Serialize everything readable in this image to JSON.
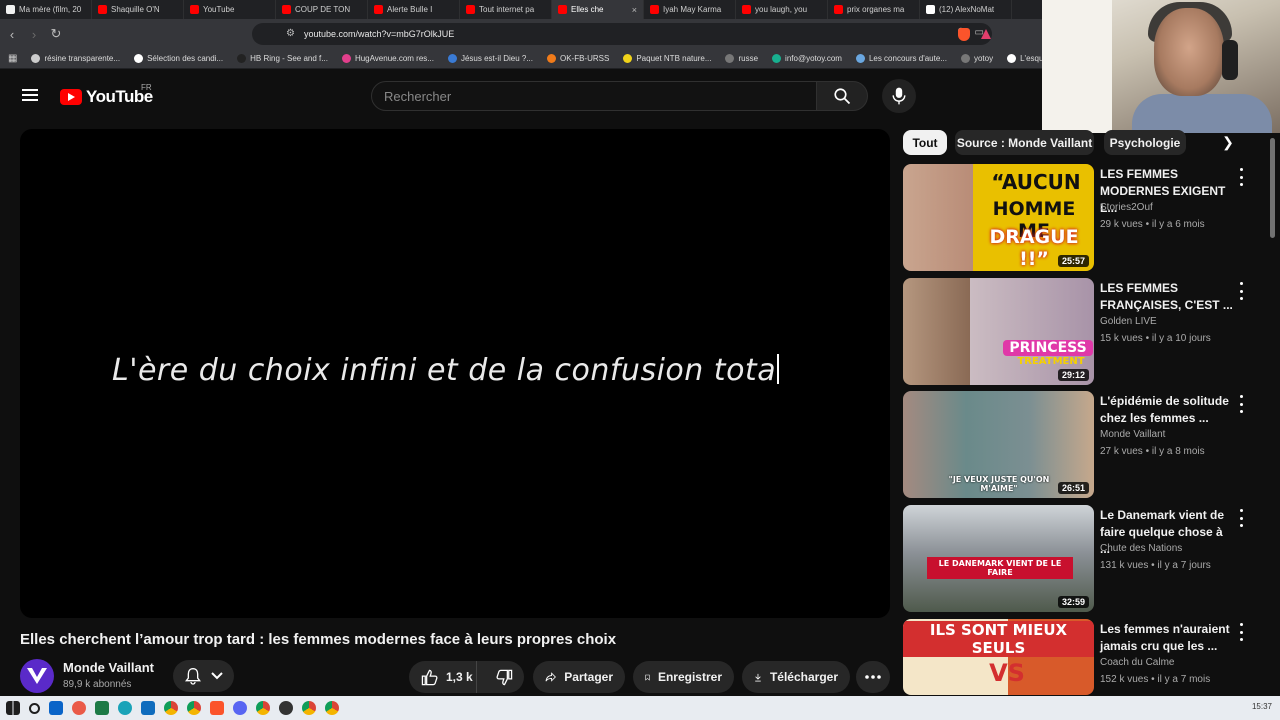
{
  "browser": {
    "tabs": [
      {
        "label": "Ma mère (film, 20",
        "color": "#f1f1f1"
      },
      {
        "label": "Shaquille O'N",
        "color": "#ff0000"
      },
      {
        "label": "YouTube",
        "color": "#ff0000"
      },
      {
        "label": "COUP DE TON",
        "color": "#ff0000"
      },
      {
        "label": "Alerte Bulle I",
        "color": "#ff0000"
      },
      {
        "label": "Tout internet pa",
        "color": "#ff0000"
      },
      {
        "label": "Elles che",
        "color": "#ff0000",
        "active": true
      },
      {
        "label": "Iyah May Karma",
        "color": "#ff0000"
      },
      {
        "label": "you laugh, you",
        "color": "#ff0000"
      },
      {
        "label": "prix organes ma",
        "color": "#ff0000"
      },
      {
        "label": "(12) AlexNoMat",
        "color": "#ffffff"
      }
    ],
    "url": "youtube.com/watch?v=mbG7rOlkJUE",
    "bookmarks": [
      {
        "label": "résine transparente...",
        "color": "#cccccc"
      },
      {
        "label": "Sélection des candi...",
        "color": "#ffffff"
      },
      {
        "label": "HB Ring - See and f...",
        "color": "#222222"
      },
      {
        "label": "HugAvenue.com res...",
        "color": "#e23f8c"
      },
      {
        "label": "Jésus est-il Dieu ?...",
        "color": "#3a7bd5"
      },
      {
        "label": "OK-FB-URSS",
        "color": "#f07b1a"
      },
      {
        "label": "Paquet NTB nature...",
        "color": "#f0d31a"
      },
      {
        "label": "russe",
        "color": "#777777"
      },
      {
        "label": "info@yotoy.com",
        "color": "#18b08f"
      },
      {
        "label": "Les concours d'aute...",
        "color": "#6aa7e0"
      },
      {
        "label": "yotoy",
        "color": "#777777"
      },
      {
        "label": "L'esqu",
        "color": "#ffffff"
      }
    ]
  },
  "youtube": {
    "logo_text": "YouTube",
    "country_code": "FR",
    "search_placeholder": "Rechercher"
  },
  "video": {
    "caption": "L'ère du choix infini et de la confusion tota",
    "title": "Elles cherchent l’amour trop tard : les femmes modernes face à leurs propres choix",
    "channel": "Monde Vaillant",
    "subscribers": "89,9 k abonnés",
    "likes": "1,3 k",
    "share_label": "Partager",
    "save_label": "Enregistrer",
    "download_label": "Télécharger"
  },
  "chips": [
    "Tout",
    "Source : Monde Vaillant",
    "Psychologie"
  ],
  "recommendations": [
    {
      "title": "LES FEMMES MODERNES EXIGENT L...",
      "channel": "Stories2Ouf",
      "meta": "29 k vues • il y a 6 mois",
      "duration": "25:57",
      "thumb_text": [
        "“AUCUN",
        "HOMME ME",
        "DRAGUE !!”"
      ],
      "colors": {
        "bg": "#e9c000",
        "accent": "#d52b1e"
      }
    },
    {
      "title": "LES FEMMES FRANÇAISES, C'EST ...",
      "channel": "Golden LIVE",
      "meta": "15 k vues • il y a 10 jours",
      "duration": "29:12",
      "thumb_text": [
        "PRINCESS",
        "TREATMENT"
      ],
      "colors": {
        "bg": "#b9a8b8",
        "accent": "#e038a8"
      }
    },
    {
      "title": "L'épidémie de solitude chez les femmes ...",
      "channel": "Monde Vaillant",
      "meta": "27 k vues • il y a 8 mois",
      "duration": "26:51",
      "thumb_text": [
        "\"JE VEUX JUSTE QU'ON M'AIME\""
      ],
      "colors": {
        "bg": "#8a7a78",
        "accent": "#ff2d2d"
      }
    },
    {
      "title": "Le Danemark vient de faire quelque chose à ...",
      "channel": "Chute des Nations",
      "meta": "131 k vues • il y a 7 jours",
      "duration": "32:59",
      "thumb_text": [
        "LE DANEMARK VIENT DE LE FAIRE"
      ],
      "colors": {
        "bg": "#6b7075",
        "accent": "#c8102e"
      }
    },
    {
      "title": "Les femmes n'auraient jamais cru que les ...",
      "channel": "Coach du Calme",
      "meta": "152 k vues • il y a 7 mois",
      "duration": "",
      "thumb_text": [
        "ILS SONT MIEUX SEULS",
        "VS"
      ],
      "colors": {
        "bg": "#d32f2f",
        "accent": "#f5d000"
      }
    }
  ],
  "system": {
    "clock": "15:37"
  }
}
